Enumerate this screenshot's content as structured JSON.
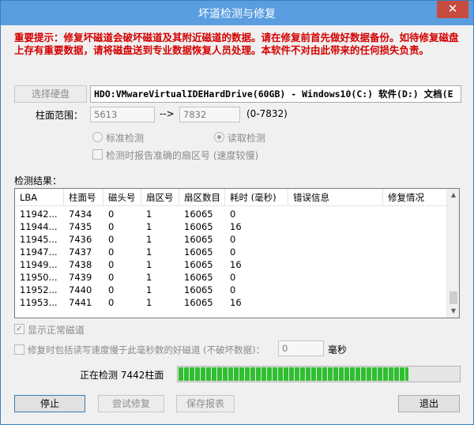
{
  "window": {
    "title": "坏道检测与修复",
    "close_glyph": "✕"
  },
  "warning": "重要提示：修复坏磁道会破坏磁道及其附近磁道的数据。请在修复前首先做好数据备份。如待修复磁盘上存有重要数据，请将磁盘送到专业数据恢复人员处理。本软件不对由此带来的任何损失负责。",
  "disk": {
    "select_button": "选择硬盘",
    "selected": "HDO:VMwareVirtualIDEHardDrive(60GB) - Windows10(C:) 软件(D:) 文档(E"
  },
  "range": {
    "label": "柱面范围：",
    "from": "5613",
    "arrow": "-->",
    "to": "7832",
    "hint": "(0-7832)"
  },
  "modes": {
    "standard": "标准检测",
    "read": "读取检测",
    "report_option": "检测时报告准确的扇区号 (速度较慢)"
  },
  "results": {
    "label": "检测结果：",
    "columns": [
      "LBA",
      "柱面号",
      "磁头号",
      "扇区号",
      "扇区数目",
      "耗时 (毫秒)",
      "错误信息",
      "修复情况"
    ],
    "rows": [
      [
        "11942...",
        "7434",
        "0",
        "1",
        "16065",
        "0",
        "",
        ""
      ],
      [
        "11944...",
        "7435",
        "0",
        "1",
        "16065",
        "16",
        "",
        ""
      ],
      [
        "11945...",
        "7436",
        "0",
        "1",
        "16065",
        "0",
        "",
        ""
      ],
      [
        "11947...",
        "7437",
        "0",
        "1",
        "16065",
        "0",
        "",
        ""
      ],
      [
        "11949...",
        "7438",
        "0",
        "1",
        "16065",
        "16",
        "",
        ""
      ],
      [
        "11950...",
        "7439",
        "0",
        "1",
        "16065",
        "0",
        "",
        ""
      ],
      [
        "11952...",
        "7440",
        "0",
        "1",
        "16065",
        "0",
        "",
        ""
      ],
      [
        "11953...",
        "7441",
        "0",
        "1",
        "16065",
        "16",
        "",
        ""
      ]
    ]
  },
  "options": {
    "show_normal": "显示正常磁道",
    "show_normal_checked": true,
    "repair_slow": "修复时包括读写速度慢于此毫秒数的好磁道 (不破坏数据)：",
    "ms_value": "0",
    "ms_unit": "毫秒"
  },
  "status": {
    "text": "正在检测 7442柱面",
    "progress_percent": 82
  },
  "buttons": {
    "stop": "停止",
    "try_repair": "尝试修复",
    "save_report": "保存报表",
    "exit": "退出"
  },
  "colors": {
    "warning": "#d40000",
    "titlebar": "#5a9ee0",
    "close": "#c74b3f",
    "progress": "#2fbf2f"
  }
}
